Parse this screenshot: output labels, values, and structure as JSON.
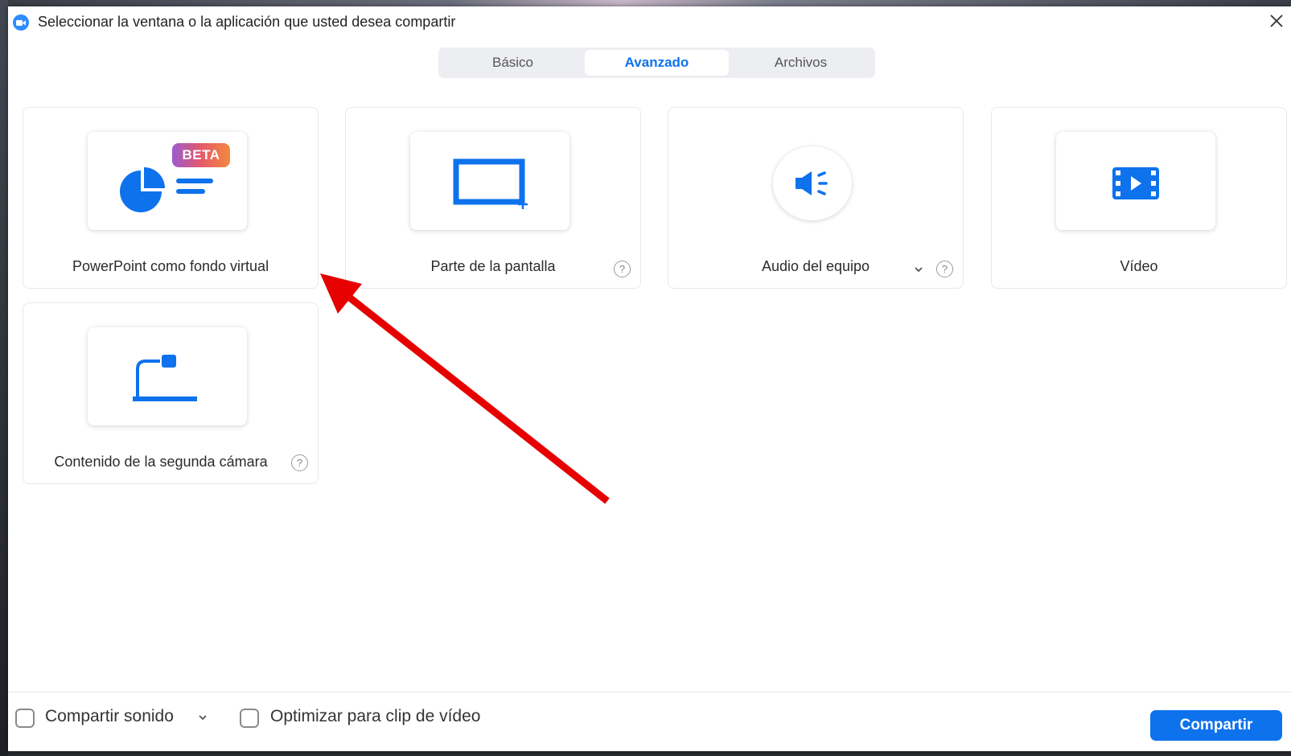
{
  "window": {
    "title": "Seleccionar la ventana o la aplicación que usted desea compartir"
  },
  "tabs": [
    {
      "label": "Básico",
      "active": false
    },
    {
      "label": "Avanzado",
      "active": true
    },
    {
      "label": "Archivos",
      "active": false
    }
  ],
  "cards": [
    {
      "label": "PowerPoint como fondo virtual",
      "badge": "BETA",
      "icon": "pie-chart-icon"
    },
    {
      "label": "Parte de la pantalla",
      "icon": "screen-portion-icon",
      "help": "?"
    },
    {
      "label": "Audio del equipo",
      "icon": "speaker-icon",
      "help": "?"
    },
    {
      "label": "Vídeo",
      "icon": "film-icon"
    },
    {
      "label": "Contenido de la segunda cámara",
      "icon": "document-camera-icon",
      "help": "?"
    }
  ],
  "footer": {
    "share_sound_label": "Compartir sonido",
    "optimize_label": "Optimizar para clip de vídeo",
    "share_button": "Compartir"
  },
  "colors": {
    "accent": "#0e72ed",
    "icon_blue": "#2d8cff",
    "arrow": "#e60000"
  }
}
